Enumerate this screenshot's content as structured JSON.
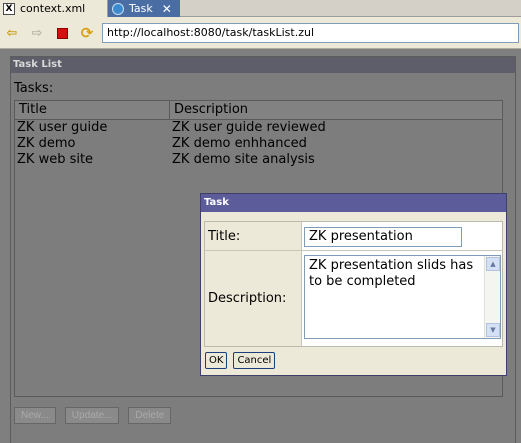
{
  "tabs": [
    {
      "label": "context.xml",
      "icon": "xml-file-icon"
    },
    {
      "label": "Task",
      "icon": "globe-icon"
    }
  ],
  "tab_close_glyph": "✕",
  "toolbar": {
    "url": "http://localhost:8080/task/taskList.zul",
    "icons": [
      "back-arrow-icon",
      "forward-arrow-icon",
      "stop-icon",
      "refresh-icon"
    ]
  },
  "task_list": {
    "window_title": "Task List",
    "tasks_label": "Tasks:",
    "columns": [
      "Title",
      "Description"
    ],
    "rows": [
      {
        "title": "ZK user guide",
        "description": "ZK user guide reviewed"
      },
      {
        "title": "ZK demo",
        "description": "ZK demo enhhanced"
      },
      {
        "title": "ZK web site",
        "description": "ZK demo site analysis"
      }
    ],
    "buttons": {
      "new": "New...",
      "update": "Update...",
      "delete": "Delete"
    }
  },
  "dialog": {
    "title": "Task",
    "title_label": "Title:",
    "title_value": "ZK presentation",
    "description_label": "Description:",
    "description_value": "ZK presentation slids has to be completed",
    "ok_label": "OK",
    "cancel_label": "Cancel"
  },
  "colors": {
    "active_tab": "#4a6ea3",
    "dialog_title_bar": "#5c5c9a",
    "stop_red": "#d41010",
    "page_overlay": "#7f7f7f"
  }
}
